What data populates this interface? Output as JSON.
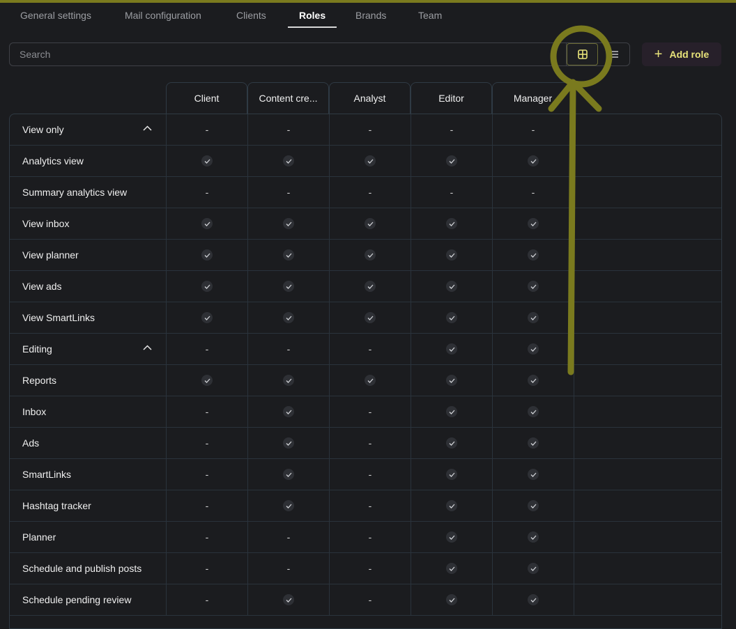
{
  "tabs": [
    {
      "label": "General settings",
      "active": false
    },
    {
      "label": "Mail configuration",
      "active": false
    },
    {
      "label": "Clients",
      "active": false
    },
    {
      "label": "Roles",
      "active": true
    },
    {
      "label": "Brands",
      "active": false
    },
    {
      "label": "Team",
      "active": false
    }
  ],
  "search": {
    "placeholder": "Search",
    "value": ""
  },
  "view_toggle": {
    "grid_icon": "grid-icon",
    "list_icon": "list-icon",
    "selected": "grid"
  },
  "add_role": {
    "label": "Add role",
    "icon": "plus-icon"
  },
  "colors": {
    "accent": "#e8e37a",
    "annotation": "#7a7a1e",
    "background": "#1b1c1f"
  },
  "roles": [
    "Client",
    "Content cre...",
    "Analyst",
    "Editor",
    "Manager"
  ],
  "permissions": [
    {
      "label": "View only",
      "group": true,
      "values": [
        "-",
        "-",
        "-",
        "-",
        "-"
      ]
    },
    {
      "label": "Analytics view",
      "group": false,
      "values": [
        "check",
        "check",
        "check",
        "check",
        "check"
      ]
    },
    {
      "label": "Summary analytics view",
      "group": false,
      "values": [
        "-",
        "-",
        "-",
        "-",
        "-"
      ]
    },
    {
      "label": "View inbox",
      "group": false,
      "values": [
        "check",
        "check",
        "check",
        "check",
        "check"
      ]
    },
    {
      "label": "View planner",
      "group": false,
      "values": [
        "check",
        "check",
        "check",
        "check",
        "check"
      ]
    },
    {
      "label": "View ads",
      "group": false,
      "values": [
        "check",
        "check",
        "check",
        "check",
        "check"
      ]
    },
    {
      "label": "View SmartLinks",
      "group": false,
      "values": [
        "check",
        "check",
        "check",
        "check",
        "check"
      ]
    },
    {
      "label": "Editing",
      "group": true,
      "values": [
        "-",
        "-",
        "-",
        "check",
        "check"
      ]
    },
    {
      "label": "Reports",
      "group": false,
      "values": [
        "check",
        "check",
        "check",
        "check",
        "check"
      ]
    },
    {
      "label": "Inbox",
      "group": false,
      "values": [
        "-",
        "check",
        "-",
        "check",
        "check"
      ]
    },
    {
      "label": "Ads",
      "group": false,
      "values": [
        "-",
        "check",
        "-",
        "check",
        "check"
      ]
    },
    {
      "label": "SmartLinks",
      "group": false,
      "values": [
        "-",
        "check",
        "-",
        "check",
        "check"
      ]
    },
    {
      "label": "Hashtag tracker",
      "group": false,
      "values": [
        "-",
        "check",
        "-",
        "check",
        "check"
      ]
    },
    {
      "label": "Planner",
      "group": false,
      "values": [
        "-",
        "-",
        "-",
        "check",
        "check"
      ]
    },
    {
      "label": "Schedule and publish posts",
      "group": false,
      "values": [
        "-",
        "-",
        "-",
        "check",
        "check"
      ]
    },
    {
      "label": "Schedule pending review",
      "group": false,
      "values": [
        "-",
        "check",
        "-",
        "check",
        "check"
      ]
    }
  ]
}
